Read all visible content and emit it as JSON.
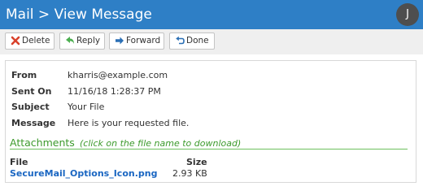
{
  "header": {
    "title": "Mail > View Message",
    "avatar_initial": "J"
  },
  "toolbar": {
    "delete_label": "Delete",
    "reply_label": "Reply",
    "forward_label": "Forward",
    "done_label": "Done",
    "icons": {
      "delete": "x-icon",
      "reply": "reply-arrow-icon",
      "forward": "forward-arrow-icon",
      "done": "return-arrow-icon"
    }
  },
  "message": {
    "fields": [
      {
        "label": "From",
        "value": "kharris@example.com"
      },
      {
        "label": "Sent On",
        "value": "11/16/18 1:28:37 PM"
      },
      {
        "label": "Subject",
        "value": "Your File"
      },
      {
        "label": "Message",
        "value": "Here is your requested file."
      }
    ]
  },
  "attachments": {
    "title": "Attachments",
    "hint": "(click on the file name to download)",
    "columns": [
      "File",
      "Size"
    ],
    "files": [
      {
        "name": "SecureMail_Options_Icon.png",
        "size": "2.93 KB"
      }
    ]
  },
  "colors": {
    "header_bg": "#2e7fc6",
    "accent_green": "#3c9a2c",
    "link_blue": "#1a66c2",
    "delete_red": "#d9412b",
    "reply_green": "#4caf50",
    "forward_blue": "#2a6fb5"
  }
}
